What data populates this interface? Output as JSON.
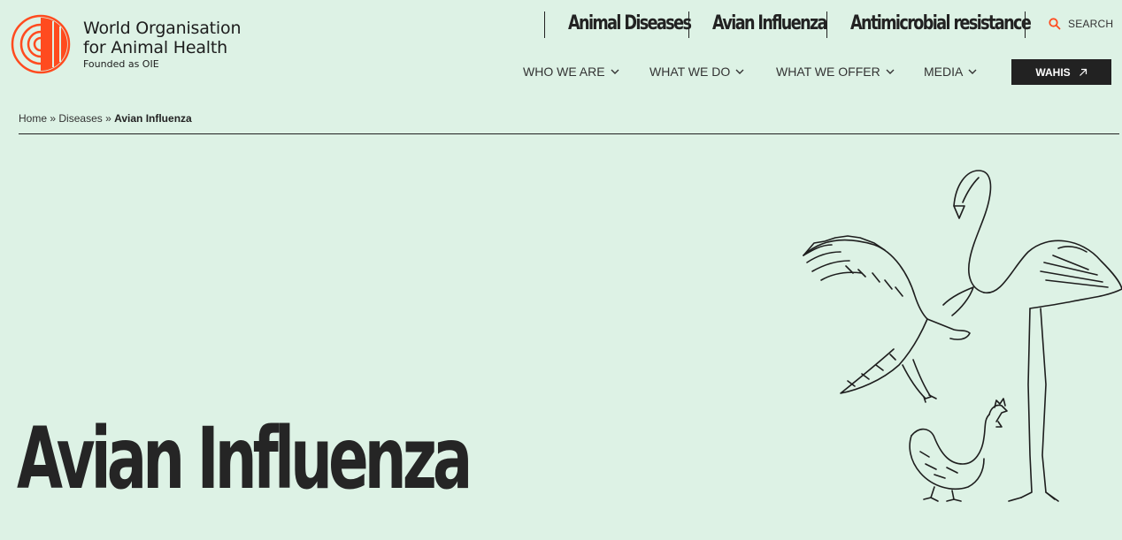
{
  "brand": {
    "line1": "World Organisation",
    "line2": "for Animal Health",
    "tagline": "Founded as OIE",
    "accent_color": "#ff4b1f"
  },
  "quick_links": [
    "Animal Diseases",
    "Avian Influenza",
    "Antimicrobial resistance"
  ],
  "search": {
    "label": "SEARCH",
    "icon": "search-icon"
  },
  "main_nav": [
    "WHO WE ARE",
    "WHAT WE DO",
    "WHAT WE OFFER",
    "MEDIA"
  ],
  "wahis": {
    "label": "WAHIS",
    "icon": "external-arrow-icon"
  },
  "breadcrumb": {
    "home": "Home",
    "sep": "»",
    "section": "Diseases",
    "current": "Avian Influenza"
  },
  "hero": {
    "title": "Avian Influenza"
  },
  "colors": {
    "background": "#ddf2e5",
    "text": "#222222",
    "accent": "#ff4b1f"
  }
}
